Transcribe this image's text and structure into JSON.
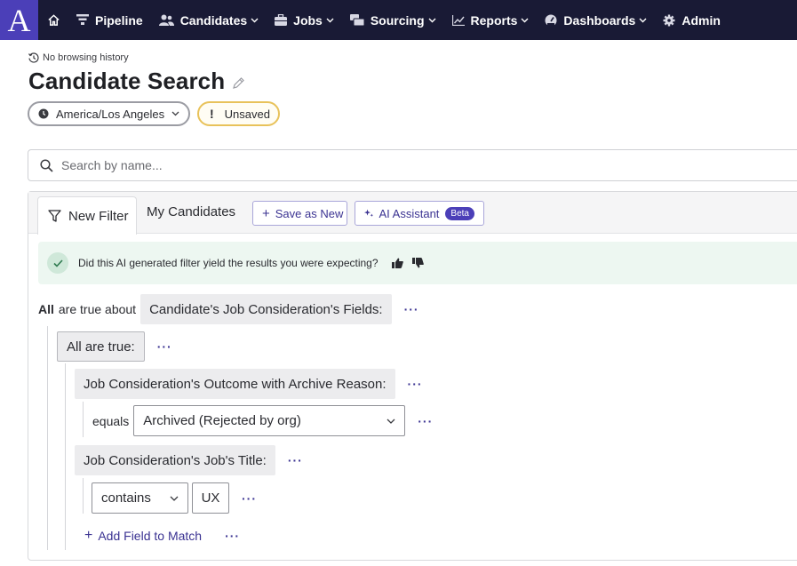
{
  "nav": {
    "logo": "A",
    "items": [
      {
        "label": "Pipeline",
        "icon": "funnel-icon",
        "chevron": false
      },
      {
        "label": "Candidates",
        "icon": "users-icon",
        "chevron": true
      },
      {
        "label": "Jobs",
        "icon": "briefcase-icon",
        "chevron": true
      },
      {
        "label": "Sourcing",
        "icon": "sourcing-icon",
        "chevron": true
      },
      {
        "label": "Reports",
        "icon": "chart-icon",
        "chevron": true
      },
      {
        "label": "Dashboards",
        "icon": "gauge-icon",
        "chevron": true
      },
      {
        "label": "Admin",
        "icon": "gear-icon",
        "chevron": false
      }
    ]
  },
  "header": {
    "history": "No browsing history",
    "title": "Candidate Search",
    "timezone": "America/Los Angeles",
    "status": "Unsaved",
    "status_mark": "!"
  },
  "search": {
    "placeholder": "Search by name..."
  },
  "filter": {
    "tab_new": "New Filter",
    "tab_mine": "My Candidates",
    "save_as_new": "Save as New",
    "ai_assistant": "AI Assistant",
    "beta": "Beta",
    "ai_question": "Did this AI generated filter yield the results you were expecting?",
    "root": {
      "quantifier": "All",
      "connector": "are true about",
      "field": "Candidate's Job Consideration's Fields:"
    },
    "group": {
      "label": "All are true:"
    },
    "conditions": [
      {
        "field": "Job Consideration's Outcome with Archive Reason:",
        "operator": "equals",
        "value": "Archived (Rejected by org)"
      },
      {
        "field": "Job Consideration's Job's Title:",
        "operator": "contains",
        "value": "UX"
      }
    ],
    "add_field": "Add Field to Match",
    "more": "···"
  },
  "colors": {
    "nav_bg": "#191a35",
    "brand": "#4b3fb8",
    "accent_text": "#3b3392",
    "unsaved_border": "#e8c25a",
    "banner_bg": "#edf7f1"
  }
}
